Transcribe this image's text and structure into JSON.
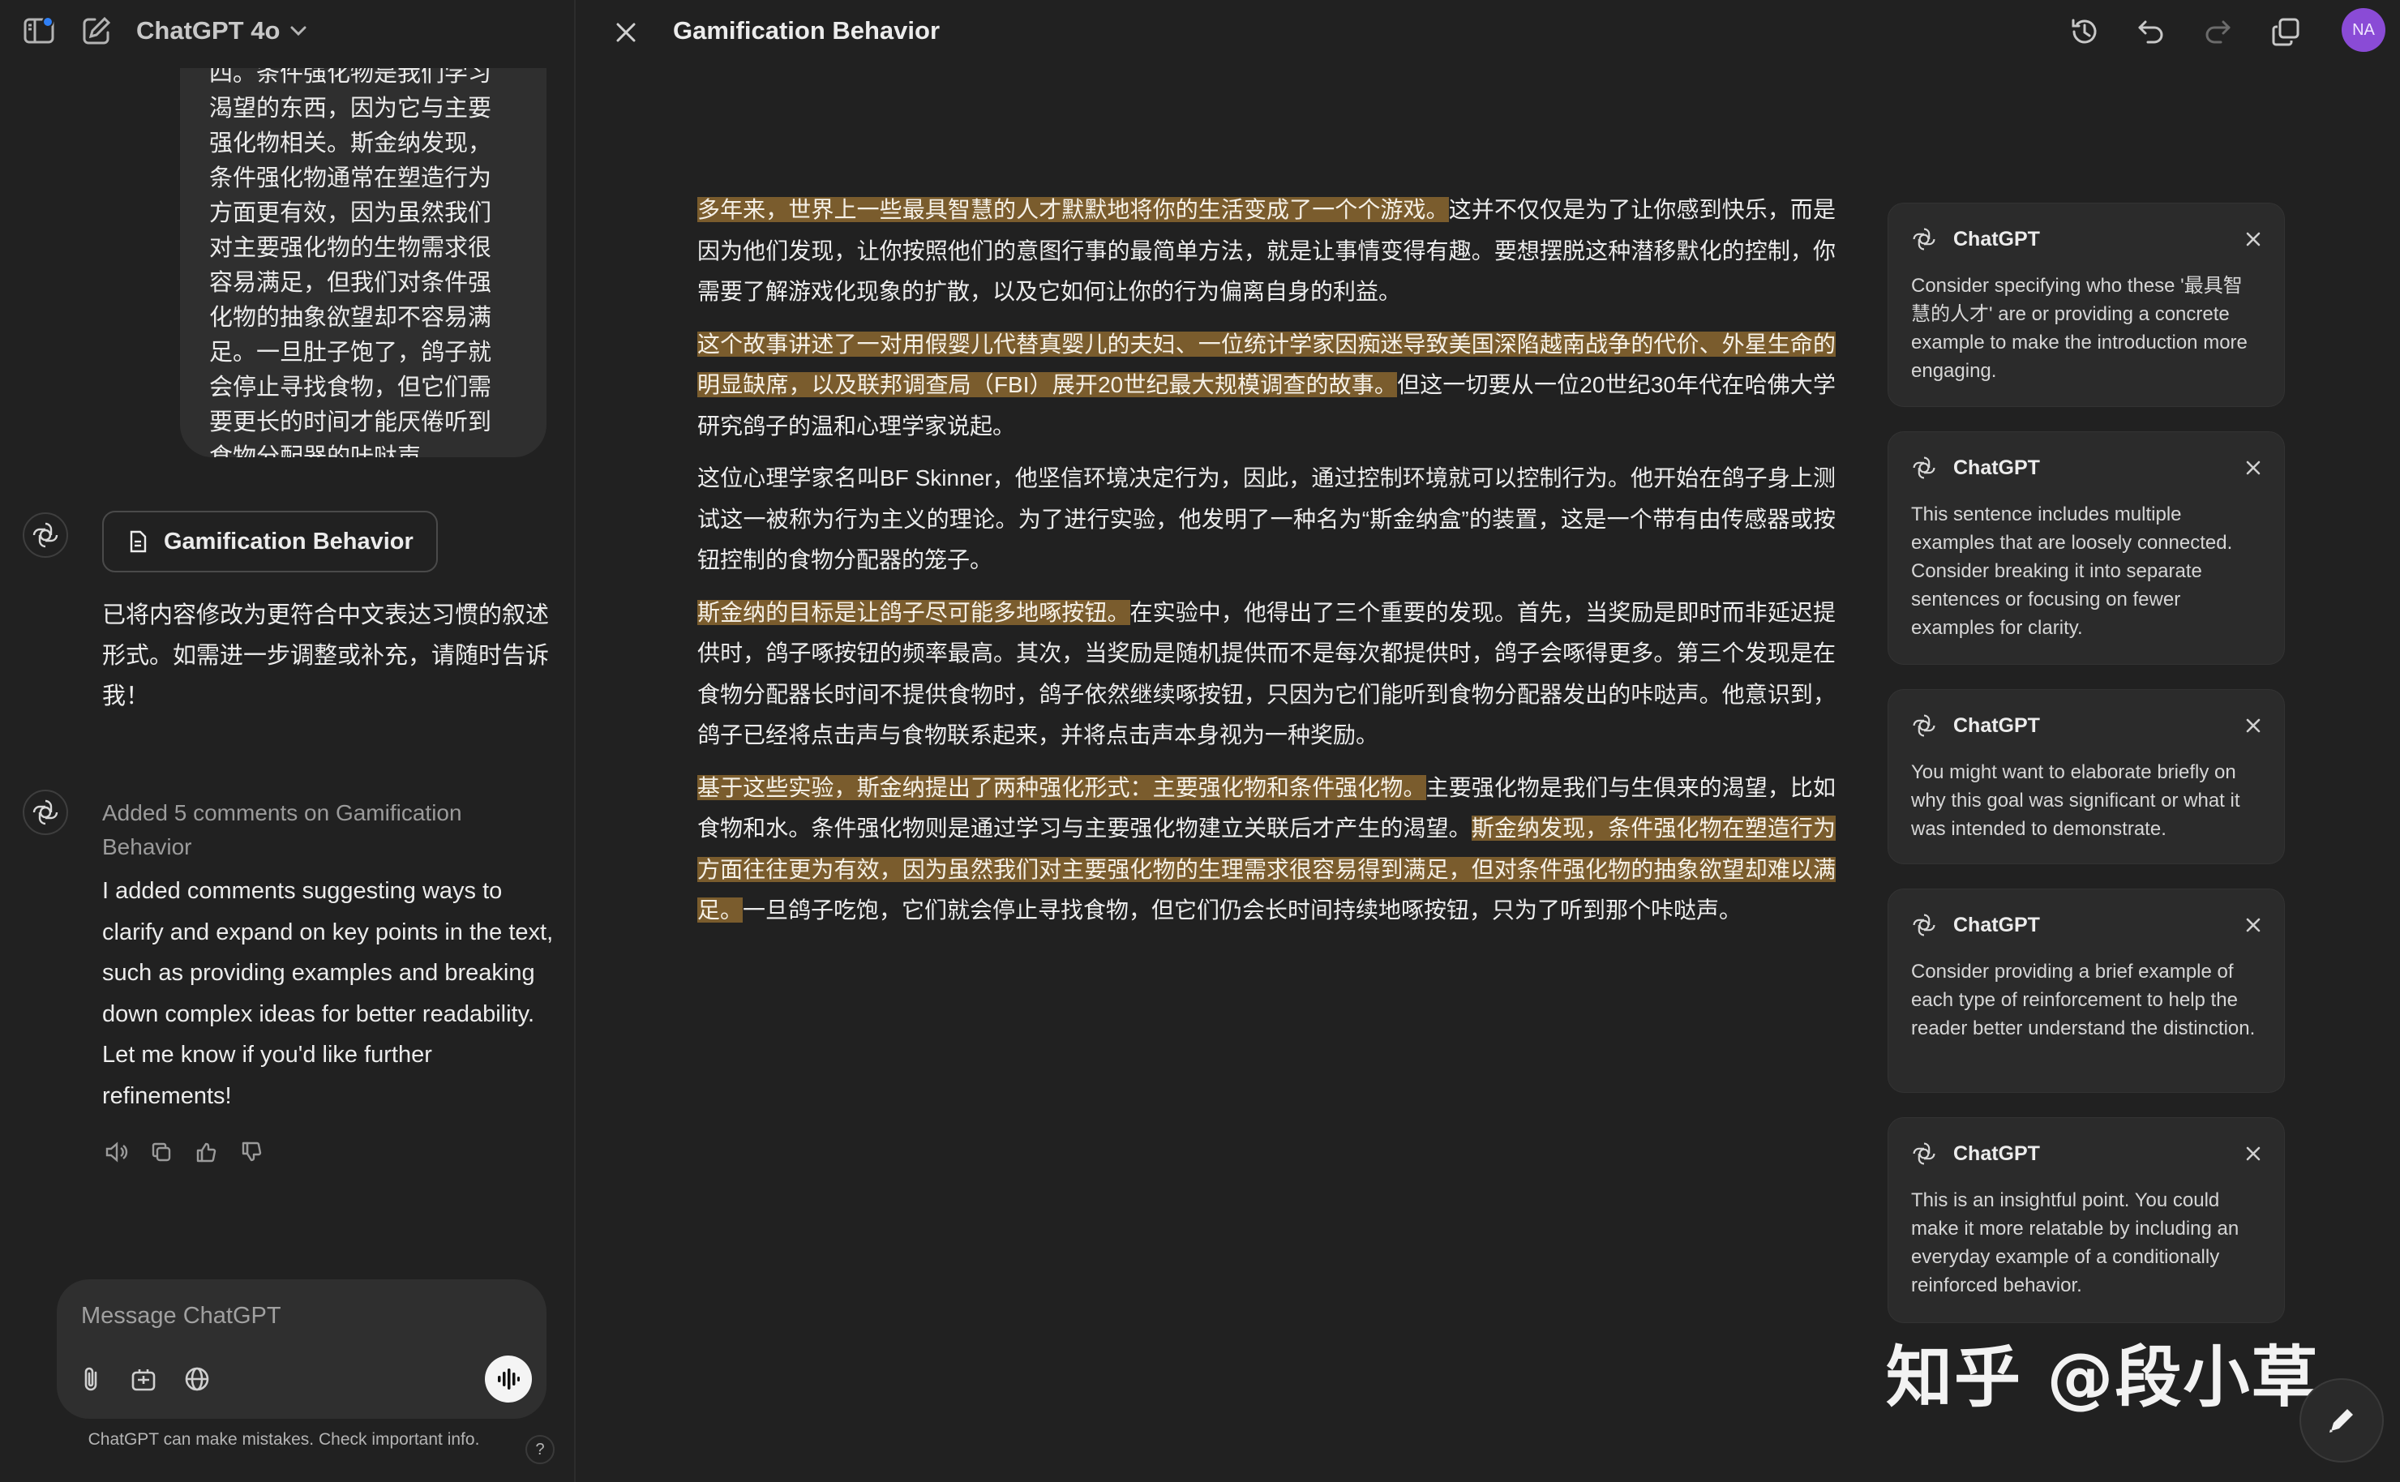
{
  "header": {
    "model_label": "ChatGPT 4o"
  },
  "chat": {
    "user_message_tail": "四。条件强化物是我们学习渴望的东西，因为它与主要强化物相关。斯金纳发现，条件强化物通常在塑造行为方面更有效，因为虽然我们对主要强化物的生物需求很容易满足，但我们对条件强化物的抽象欲望却不容易满足。一旦肚子饱了，鸽子就会停止寻找食物，但它们需要更长的时间才能厌倦听到食物分配器的咔哒声。",
    "canvas_chip_label": "Gamification Behavior",
    "assistant_reply_1": "已将内容修改为更符合中文表达习惯的叙述形式。如需进一步调整或补充，请随时告诉我！",
    "comment_status": "Added 5 comments on Gamification Behavior",
    "assistant_reply_2": "I added comments suggesting ways to clarify and expand on key points in the text, such as providing examples and breaking down complex ideas for better readability. Let me know if you'd like further refinements!"
  },
  "composer": {
    "placeholder": "Message ChatGPT",
    "disclaimer": "ChatGPT can make mistakes. Check important info.",
    "help_label": "?"
  },
  "canvas": {
    "title": "Gamification Behavior",
    "user_initials": "NA",
    "highlight_color": "#7a5c2d",
    "paragraphs": [
      {
        "hl": "多年来，世界上一些最具智慧的人才默默地将你的生活变成了一个个游戏。",
        "rest": "这并不仅仅是为了让你感到快乐，而是因为他们发现，让你按照他们的意图行事的最简单方法，就是让事情变得有趣。要想摆脱这种潜移默化的控制，你需要了解游戏化现象的扩散，以及它如何让你的行为偏离自身的利益。"
      },
      {
        "hl": "这个故事讲述了一对用假婴儿代替真婴儿的夫妇、一位统计学家因痴迷导致美国深陷越南战争的代价、外星生命的明显缺席，以及联邦调查局（FBI）展开20世纪最大规模调查的故事。",
        "rest": "但这一切要从一位20世纪30年代在哈佛大学研究鸽子的温和心理学家说起。"
      },
      {
        "plain": "这位心理学家名叫BF Skinner，他坚信环境决定行为，因此，通过控制环境就可以控制行为。他开始在鸽子身上测试这一被称为行为主义的理论。为了进行实验，他发明了一种名为“斯金纳盒”的装置，这是一个带有由传感器或按钮控制的食物分配器的笼子。"
      },
      {
        "hl": "斯金纳的目标是让鸽子尽可能多地啄按钮。",
        "rest": "在实验中，他得出了三个重要的发现。首先，当奖励是即时而非延迟提供时，鸽子啄按钮的频率最高。其次，当奖励是随机提供而不是每次都提供时，鸽子会啄得更多。第三个发现是在食物分配器长时间不提供食物时，鸽子依然继续啄按钮，只因为它们能听到食物分配器发出的咔哒声。他意识到，鸽子已经将点击声与食物联系起来，并将点击声本身视为一种奖励。"
      },
      {
        "hl": "基于这些实验，斯金纳提出了两种强化形式：主要强化物和条件强化物。",
        "mid": "主要强化物是我们与生俱来的渴望，比如食物和水。条件强化物则是通过学习与主要强化物建立关联后才产生的渴望。",
        "hl2": "斯金纳发现，条件强化物在塑造行为方面往往更为有效，因为虽然我们对主要强化物的生理需求很容易得到满足，但对条件强化物的抽象欲望却难以满足。",
        "rest": "一旦鸽子吃饱，它们就会停止寻找食物，但它们仍会长时间持续地啄按钮，只为了听到那个咔哒声。"
      }
    ]
  },
  "comments": [
    {
      "author": "ChatGPT",
      "text": "Consider specifying who these '最具智慧的人才' are or providing a concrete example to make the introduction more engaging."
    },
    {
      "author": "ChatGPT",
      "text": "This sentence includes multiple examples that are loosely connected. Consider breaking it into separate sentences or focusing on fewer examples for clarity."
    },
    {
      "author": "ChatGPT",
      "text": "You might want to elaborate briefly on why this goal was significant or what it was intended to demonstrate."
    },
    {
      "author": "ChatGPT",
      "text": "Consider providing a brief example of each type of reinforcement to help the reader better understand the distinction."
    },
    {
      "author": "ChatGPT",
      "text": "This is an insightful point. You could make it more relatable by including an everyday example of a conditionally reinforced behavior."
    }
  ],
  "watermark": "知乎 @段小草"
}
